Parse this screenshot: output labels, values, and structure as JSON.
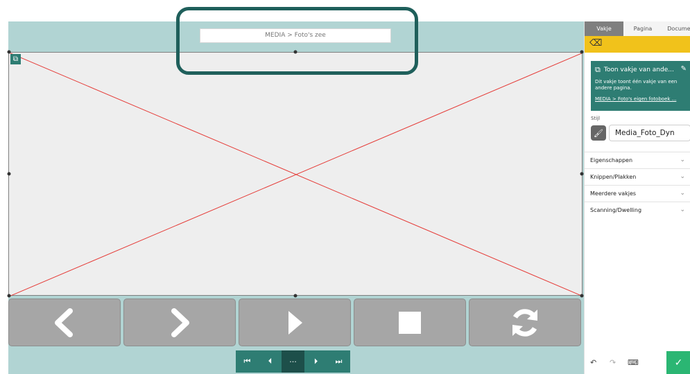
{
  "editor": {
    "cell_name": "MEDIA > Foto's zee"
  },
  "sidebar": {
    "tabs": [
      {
        "label": "Vakje",
        "active": true
      },
      {
        "label": "Pagina",
        "active": false
      },
      {
        "label": "Document",
        "active": false
      }
    ],
    "info": {
      "title": "Toon vakje van ande...",
      "description": "Dit vakje toont één vakje van een andere pagina.",
      "link": "MEDIA > Foto's eigen fotoboek ..."
    },
    "style": {
      "label": "Stijl",
      "value": "Media_Foto_Dyn"
    },
    "sections": [
      "Eigenschappen",
      "Knippen/Plakken",
      "Meerdere vakjes",
      "Scanning/Dwelling"
    ]
  },
  "colors": {
    "editor_bg": "#b1d4d3",
    "teal": "#2e7d73",
    "yellow": "#f1c21b",
    "confirm": "#2bb673",
    "highlight": "#1f5f5b"
  },
  "icons": {
    "nav_buttons": [
      "chevron-left-icon",
      "chevron-right-icon",
      "play-icon",
      "stop-icon",
      "refresh-icon"
    ],
    "pager": [
      "first-page-icon",
      "previous-page-icon",
      "more-icon",
      "next-page-icon",
      "last-page-icon"
    ]
  }
}
